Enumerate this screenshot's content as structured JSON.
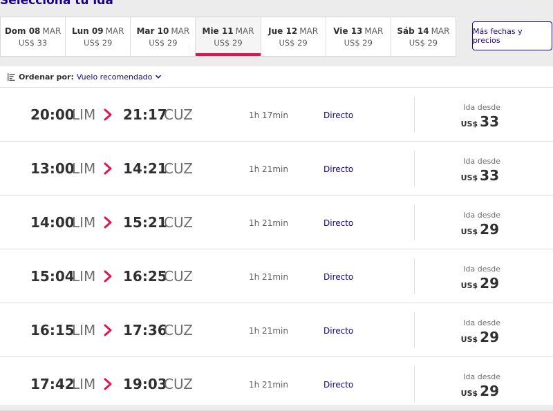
{
  "header": {
    "title": "Selecciona tu ida"
  },
  "dates": [
    {
      "day": "Dom 08",
      "month": "MAR",
      "price": "US$ 33",
      "selected": false
    },
    {
      "day": "Lun 09",
      "month": "MAR",
      "price": "US$ 29",
      "selected": false
    },
    {
      "day": "Mar 10",
      "month": "MAR",
      "price": "US$ 29",
      "selected": false
    },
    {
      "day": "Mie 11",
      "month": "MAR",
      "price": "US$ 29",
      "selected": true
    },
    {
      "day": "Jue 12",
      "month": "MAR",
      "price": "US$ 29",
      "selected": false
    },
    {
      "day": "Vie 13",
      "month": "MAR",
      "price": "US$ 29",
      "selected": false
    },
    {
      "day": "Sáb 14",
      "month": "MAR",
      "price": "US$ 29",
      "selected": false
    }
  ],
  "more_dates_label": "Más fechas y precios",
  "sort": {
    "label": "Ordenar por:",
    "value": "Vuelo recomendado"
  },
  "flights": [
    {
      "dep_time": "20:00",
      "dep_code": "LIM",
      "arr_time": "21:17",
      "arr_code": "CUZ",
      "duration": "1h 17min",
      "stops": "Directo",
      "price_label": "Ida desde",
      "currency": "US$",
      "price": "33"
    },
    {
      "dep_time": "13:00",
      "dep_code": "LIM",
      "arr_time": "14:21",
      "arr_code": "CUZ",
      "duration": "1h 21min",
      "stops": "Directo",
      "price_label": "Ida desde",
      "currency": "US$",
      "price": "33"
    },
    {
      "dep_time": "14:00",
      "dep_code": "LIM",
      "arr_time": "15:21",
      "arr_code": "CUZ",
      "duration": "1h 21min",
      "stops": "Directo",
      "price_label": "Ida desde",
      "currency": "US$",
      "price": "29"
    },
    {
      "dep_time": "15:04",
      "dep_code": "LIM",
      "arr_time": "16:25",
      "arr_code": "CUZ",
      "duration": "1h 21min",
      "stops": "Directo",
      "price_label": "Ida desde",
      "currency": "US$",
      "price": "29"
    },
    {
      "dep_time": "16:15",
      "dep_code": "LIM",
      "arr_time": "17:36",
      "arr_code": "CUZ",
      "duration": "1h 21min",
      "stops": "Directo",
      "price_label": "Ida desde",
      "currency": "US$",
      "price": "29"
    },
    {
      "dep_time": "17:42",
      "dep_code": "LIM",
      "arr_time": "19:03",
      "arr_code": "CUZ",
      "duration": "1h 21min",
      "stops": "Directo",
      "price_label": "Ida desde",
      "currency": "US$",
      "price": "29"
    }
  ],
  "icons": {
    "sort": "sort-icon",
    "arrow": "chevron-right-icon",
    "dropdown": "chevron-down-icon"
  },
  "colors": {
    "brand": "#1b0088",
    "accent": "#e8114b"
  }
}
